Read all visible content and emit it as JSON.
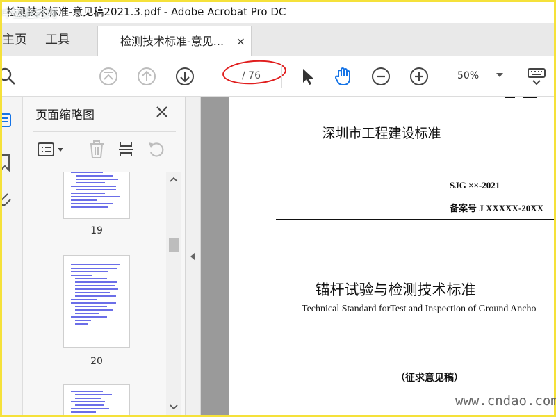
{
  "window": {
    "title": "检测技术标准-意见稿2021.3.pdf - Adobe Acrobat Pro DC"
  },
  "tabs": {
    "home": "主页",
    "tools": "工具",
    "document": "检测技术标准-意见...",
    "close": "×"
  },
  "toolbar": {
    "page_current": "",
    "page_total": "/ 76",
    "zoom": "50%"
  },
  "panel": {
    "title": "页面缩略图",
    "thumbnails": [
      {
        "number": "19"
      },
      {
        "number": "20"
      },
      {
        "number": ""
      }
    ]
  },
  "document": {
    "header": "深圳市工程建设标准",
    "code": "SJG ××-2021",
    "record": "备案号 J XXXXX-20XX",
    "title_cn": "锚杆试验与检测技术标准",
    "title_en": "Technical Standard forTest and Inspection of Ground Ancho",
    "draft": "（征求意见稿）"
  },
  "watermark": {
    "top": "中国道路网",
    "bottom": "www.cndao.com"
  },
  "colors": {
    "frame": "#f5e13a",
    "highlight_ellipse": "#e01d1d",
    "hand_tool": "#1473e6",
    "thumb_text": "#3a3ee0"
  }
}
